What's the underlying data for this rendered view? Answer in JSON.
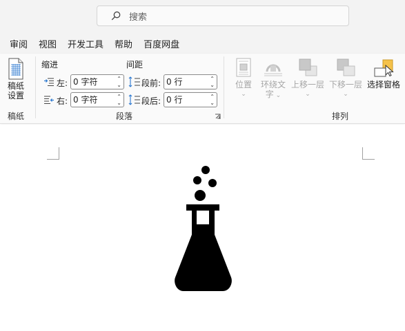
{
  "search": {
    "placeholder": "搜索"
  },
  "tabs": [
    {
      "label": "审阅"
    },
    {
      "label": "视图"
    },
    {
      "label": "开发工具"
    },
    {
      "label": "帮助"
    },
    {
      "label": "百度网盘"
    }
  ],
  "ribbon": {
    "gaozhi": {
      "button_label_line1": "稿纸",
      "button_label_line2": "设置",
      "group_label": "稿纸"
    },
    "paragraph": {
      "indent_header": "缩进",
      "spacing_header": "间距",
      "left_label": "左:",
      "right_label": "右:",
      "before_label": "段前:",
      "after_label": "段后:",
      "left_value": "0 字符",
      "right_value": "0 字符",
      "before_value": "0 行",
      "after_value": "0 行",
      "group_label": "段落"
    },
    "arrange": {
      "position_label": "位置",
      "wrap_label_line1": "环绕文",
      "wrap_label_line2": "字",
      "bring_forward_label": "上移一层",
      "send_backward_label": "下移一层",
      "selection_pane_label": "选择窗格",
      "group_label": "排列"
    }
  },
  "colors": {
    "ribbon_bg": "#fafafa",
    "titlebar_bg": "#f3f3f3",
    "disabled_text": "#a6a6a6",
    "accent_blue": "#2b78d0",
    "pane_yellow": "#f5c24a"
  },
  "document": {
    "image": "flask-icon"
  }
}
